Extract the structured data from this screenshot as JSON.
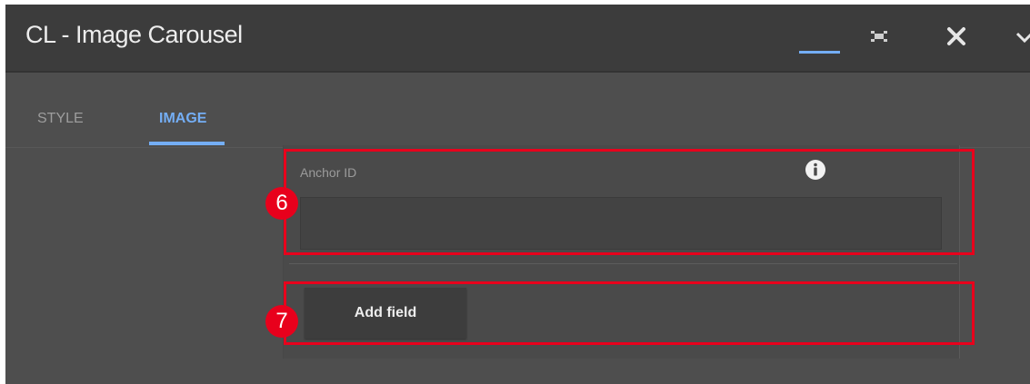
{
  "window": {
    "title": "CL - Image Carousel"
  },
  "tabs": [
    {
      "label": "STYLE",
      "active": false
    },
    {
      "label": "IMAGE",
      "active": true
    }
  ],
  "form": {
    "anchor_label": "Anchor ID",
    "anchor_value": "",
    "add_field_label": "Add field"
  },
  "annotations": {
    "badge_6": "6",
    "badge_7": "7"
  },
  "icons": {
    "minimize": "minimize-icon",
    "fullscreen": "fullscreen-icon",
    "close": "close-icon",
    "chevron": "chevron-down-icon",
    "info": "info-icon"
  },
  "colors": {
    "accent": "#74aef5",
    "highlight": "#e8001c",
    "header_bg": "#3c3c3c",
    "body_bg": "#4e4e4e"
  }
}
